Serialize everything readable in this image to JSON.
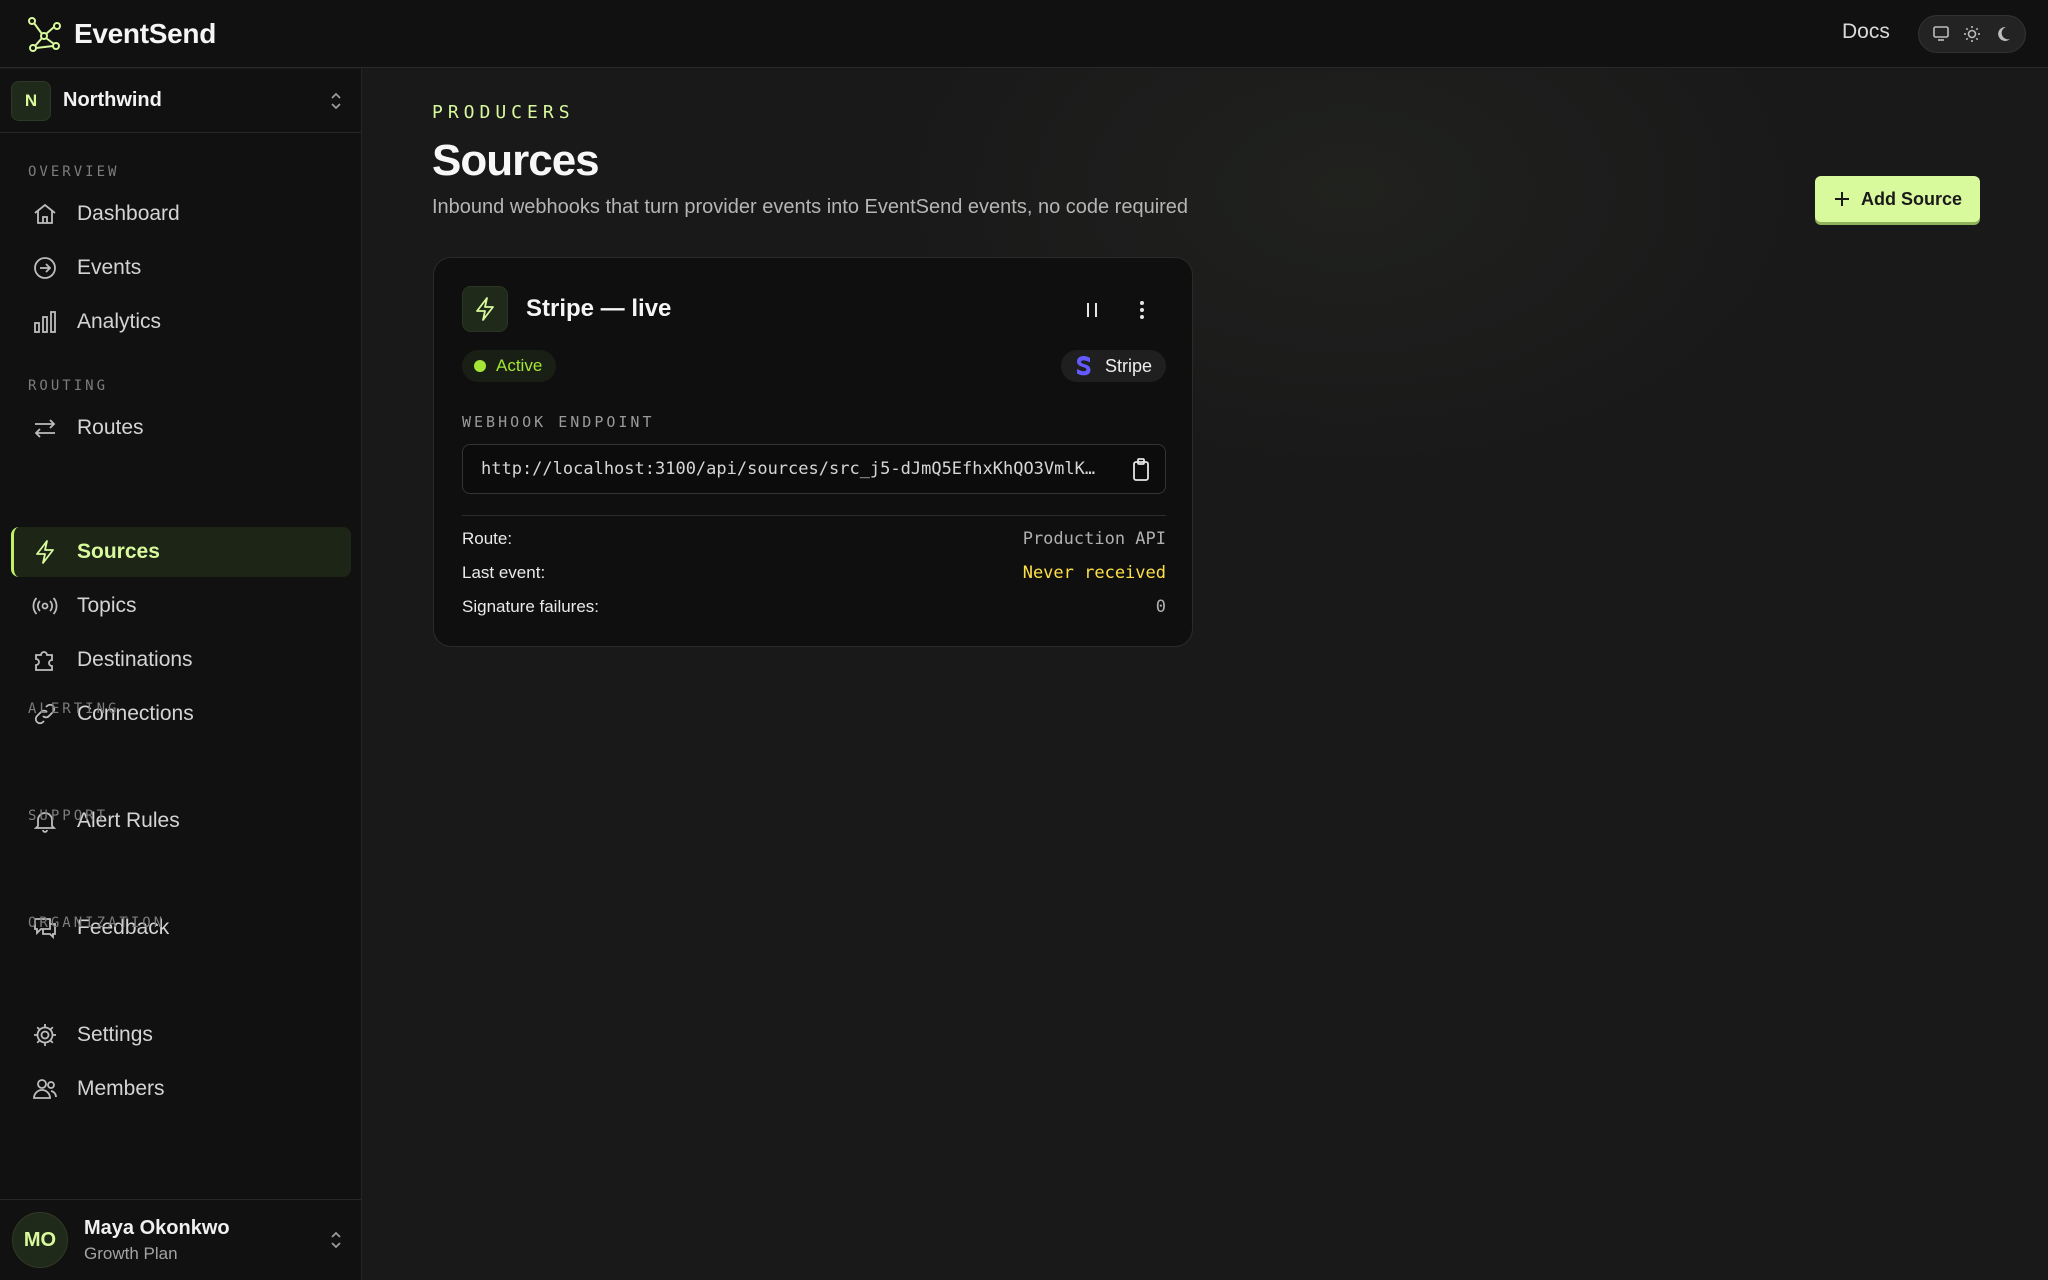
{
  "topbar": {
    "brand": "EventSend",
    "docs_label": "Docs",
    "theme_options": [
      "system-icon",
      "sun-icon",
      "moon-icon"
    ]
  },
  "sidebar": {
    "org": {
      "initial": "N",
      "name": "Northwind"
    },
    "sections": [
      {
        "label": "OVERVIEW",
        "items": [
          {
            "label": "Dashboard",
            "icon": "home-icon"
          },
          {
            "label": "Events",
            "icon": "arrow-circle-icon"
          },
          {
            "label": "Analytics",
            "icon": "bar-chart-icon"
          }
        ]
      },
      {
        "label": "ROUTING",
        "items": [
          {
            "label": "Routes",
            "icon": "swap-arrows-icon"
          },
          {
            "label": "Sources",
            "icon": "bolt-icon",
            "active": true
          },
          {
            "label": "Topics",
            "icon": "broadcast-icon"
          },
          {
            "label": "Destinations",
            "icon": "puzzle-icon"
          },
          {
            "label": "Connections",
            "icon": "link-icon"
          }
        ]
      },
      {
        "label": "ALERTING",
        "items": [
          {
            "label": "Alert Rules",
            "icon": "bell-icon"
          }
        ]
      },
      {
        "label": "SUPPORT",
        "items": [
          {
            "label": "Feedback",
            "icon": "chat-icon"
          }
        ]
      },
      {
        "label": "ORGANIZATION",
        "items": [
          {
            "label": "Settings",
            "icon": "gear-icon"
          },
          {
            "label": "Members",
            "icon": "users-icon"
          }
        ]
      }
    ],
    "user": {
      "initials": "MO",
      "name": "Maya Okonkwo",
      "plan": "Growth Plan"
    }
  },
  "main": {
    "eyebrow": "PRODUCERS",
    "title": "Sources",
    "subtitle": "Inbound webhooks that turn provider events into EventSend events, no code required",
    "add_button": "Add Source",
    "card": {
      "title": "Stripe — live",
      "status": "Active",
      "provider": "Stripe",
      "endpoint_label": "WEBHOOK ENDPOINT",
      "endpoint_url": "http://localhost:3100/api/sources/src_j5-dJmQ5EfhxKhQO3VmlK…",
      "rows": [
        {
          "key": "Route:",
          "value": "Production API"
        },
        {
          "key": "Last event:",
          "value": "Never received"
        },
        {
          "key": "Signature failures:",
          "value": "0"
        }
      ]
    }
  },
  "colors": {
    "accent": "#d9f99d",
    "status_active": "#a3e635",
    "warning": "#fde047",
    "stripe": "#635bff"
  }
}
